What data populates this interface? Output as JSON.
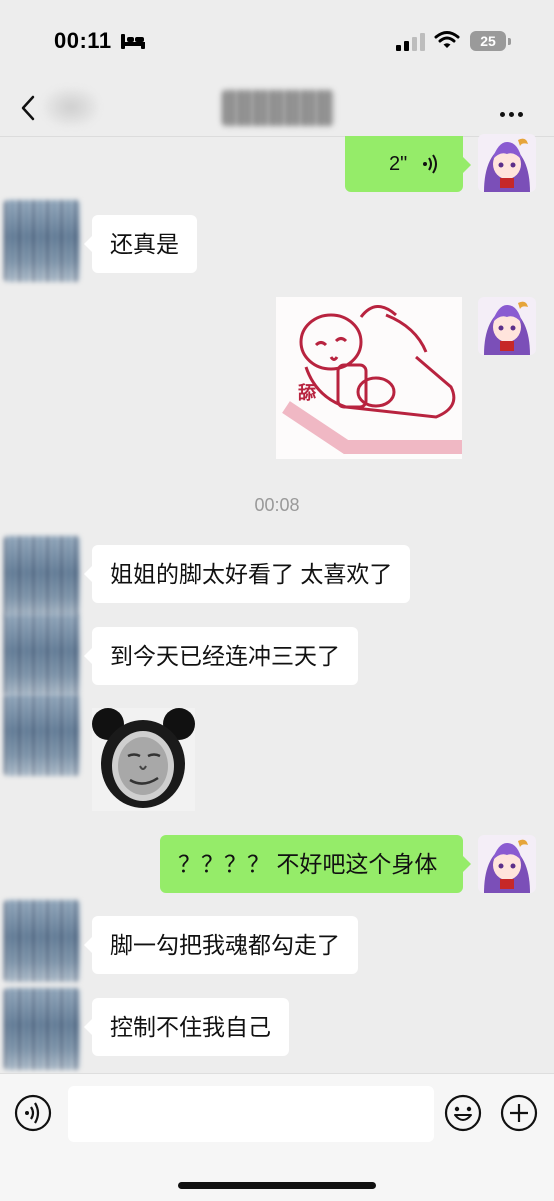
{
  "status_bar": {
    "time": "00:11",
    "battery": "25"
  },
  "chat": {
    "voice_message": {
      "duration": "2\""
    },
    "timestamp": "00:08",
    "messages": [
      {
        "side": "left",
        "text": "还真是"
      },
      {
        "side": "left",
        "text": "姐姐的脚太好看了 太喜欢了"
      },
      {
        "side": "left",
        "text": "到今天已经连冲三天了"
      },
      {
        "side": "right",
        "text": "？？？？ 不好吧这个身体"
      },
      {
        "side": "left",
        "text": "脚一勾把我魂都勾走了"
      },
      {
        "side": "left",
        "text": "控制不住我自己"
      }
    ],
    "sticker_caption": "舔"
  },
  "colors": {
    "sent_bubble": "#95ec69",
    "received_bubble": "#ffffff",
    "background": "#ededed"
  },
  "icons": {
    "back": "chevron-left-icon",
    "more": "more-dots-icon",
    "voice": "voice-wave-icon",
    "emoji": "emoji-icon",
    "plus": "plus-icon"
  }
}
